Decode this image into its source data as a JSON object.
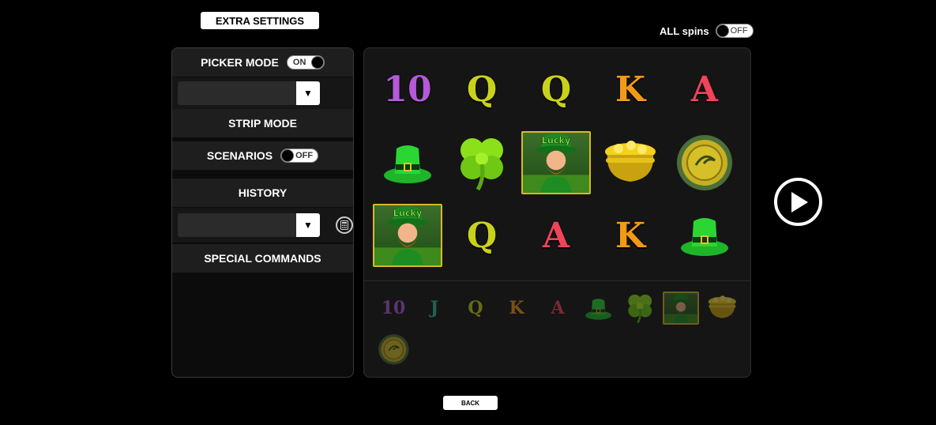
{
  "header": {
    "extra_settings_label": "EXTRA SETTINGS"
  },
  "all_spins": {
    "label": "ALL spins",
    "state": "OFF"
  },
  "left_panel": {
    "picker_mode": {
      "label": "PICKER MODE",
      "state": "ON"
    },
    "strip_mode": {
      "label": "STRIP MODE"
    },
    "scenarios": {
      "label": "SCENARIOS",
      "state": "OFF"
    },
    "history": {
      "label": "HISTORY"
    },
    "special_commands": {
      "label": "SPECIAL COMMANDS"
    },
    "dropdown_arrow": "▼"
  },
  "reels": {
    "rows": [
      [
        {
          "kind": "letter",
          "text": "10",
          "color": "#b45ad8"
        },
        {
          "kind": "letter",
          "text": "Q",
          "color": "#c9d21a"
        },
        {
          "kind": "letter",
          "text": "Q",
          "color": "#c9d21a"
        },
        {
          "kind": "letter",
          "text": "K",
          "color": "#f29a18"
        },
        {
          "kind": "letter",
          "text": "A",
          "color": "#f0445a"
        }
      ],
      [
        {
          "kind": "hat"
        },
        {
          "kind": "clover"
        },
        {
          "kind": "leprechaun",
          "text": "Lucky"
        },
        {
          "kind": "pot"
        },
        {
          "kind": "coin"
        }
      ],
      [
        {
          "kind": "leprechaun",
          "text": "Lucky"
        },
        {
          "kind": "letter",
          "text": "Q",
          "color": "#c9d21a"
        },
        {
          "kind": "letter",
          "text": "A",
          "color": "#f0445a"
        },
        {
          "kind": "letter",
          "text": "K",
          "color": "#f29a18"
        },
        {
          "kind": "hat"
        }
      ]
    ]
  },
  "symbol_picker": [
    {
      "kind": "letter",
      "text": "10",
      "color": "#b45ad8"
    },
    {
      "kind": "letter",
      "text": "J",
      "color": "#2fbf9f"
    },
    {
      "kind": "letter",
      "text": "Q",
      "color": "#c9d21a"
    },
    {
      "kind": "letter",
      "text": "K",
      "color": "#f29a18"
    },
    {
      "kind": "letter",
      "text": "A",
      "color": "#f0445a"
    },
    {
      "kind": "hat"
    },
    {
      "kind": "clover"
    },
    {
      "kind": "leprechaun"
    },
    {
      "kind": "pot"
    },
    {
      "kind": "coin"
    }
  ],
  "footer": {
    "back_label": "BACK"
  },
  "icons": {
    "play": "play-icon",
    "calculator": "calculator-icon"
  }
}
